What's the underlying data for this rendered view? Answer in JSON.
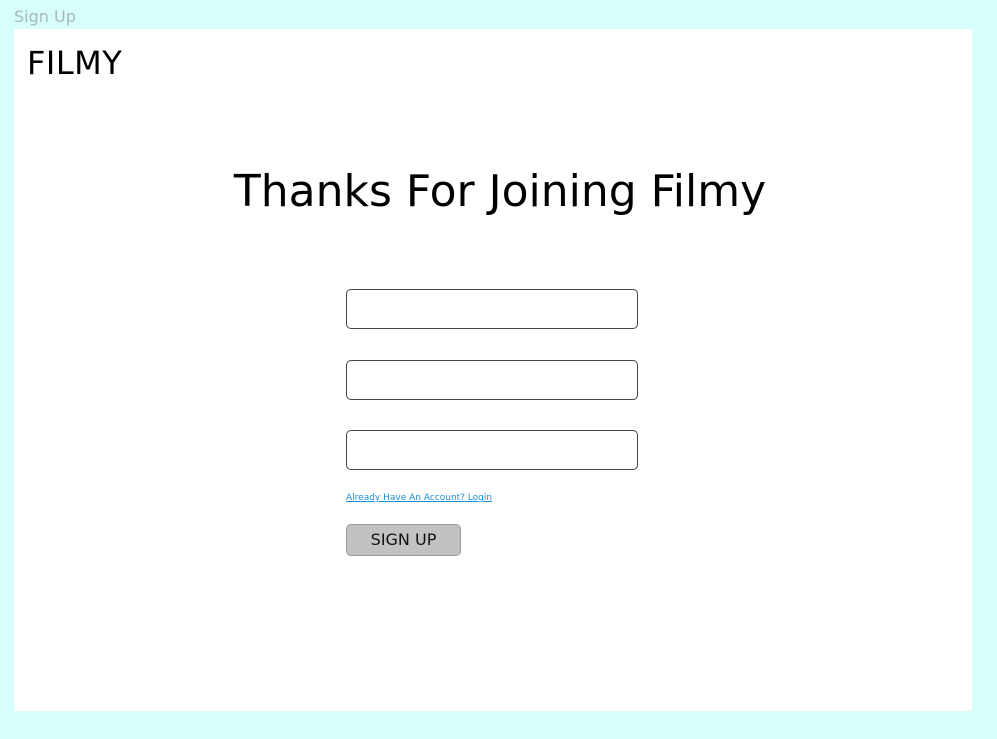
{
  "frame": {
    "label": "Sign Up"
  },
  "header": {
    "brand": "FILMY"
  },
  "main": {
    "heading": "Thanks For Joining Filmy",
    "fields": [
      {
        "value": "",
        "placeholder": ""
      },
      {
        "value": "",
        "placeholder": ""
      },
      {
        "value": "",
        "placeholder": ""
      }
    ],
    "login_link": "Already Have An Account? Login",
    "signup_button": "SIGN UP"
  },
  "colors": {
    "canvas_background": "#d6fffb",
    "frame_background": "#ffffff",
    "link": "#1a8fd6",
    "button_background": "#c2c2c2"
  }
}
